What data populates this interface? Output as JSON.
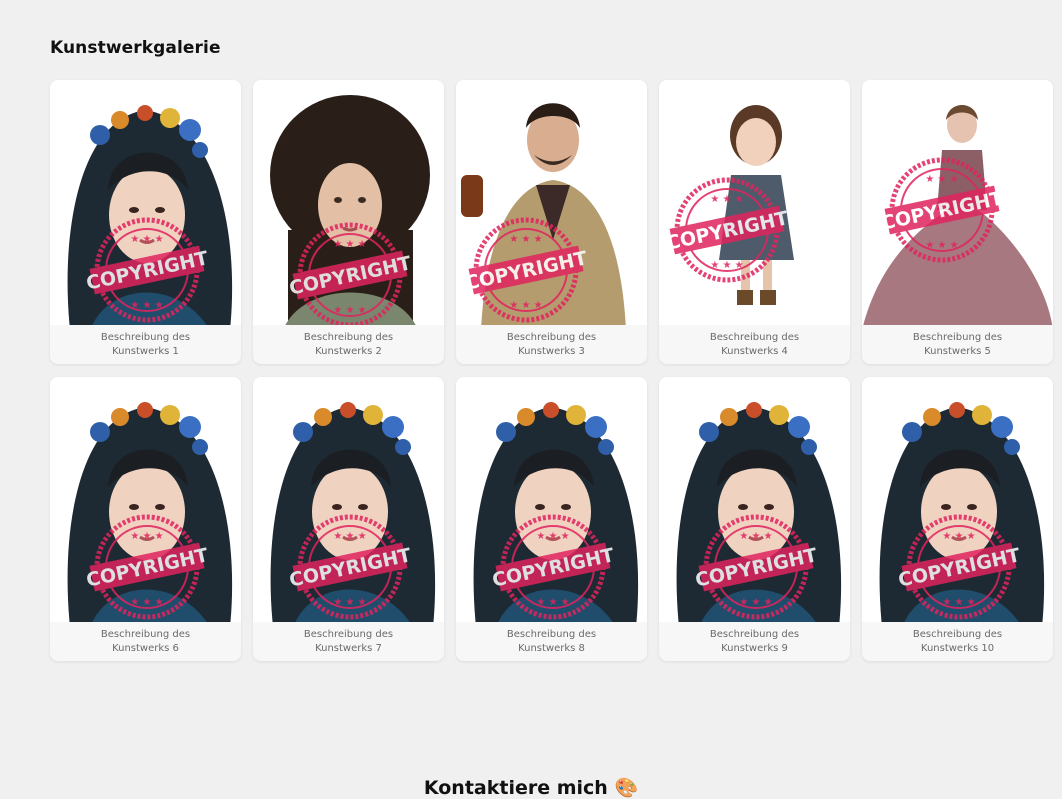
{
  "gallery": {
    "title": "Kunstwerkgalerie",
    "items": [
      {
        "caption_line1": "Beschreibung des",
        "caption_line2": "Kunstwerks 1",
        "subject": "woman-flower-crown",
        "stamp_text": "COPYRIGHT"
      },
      {
        "caption_line1": "Beschreibung des",
        "caption_line2": "Kunstwerks 2",
        "subject": "curly-hair-woman",
        "stamp_text": "COPYRIGHT"
      },
      {
        "caption_line1": "Beschreibung des",
        "caption_line2": "Kunstwerks 3",
        "subject": "man-in-suit",
        "stamp_text": "COPYRIGHT"
      },
      {
        "caption_line1": "Beschreibung des",
        "caption_line2": "Kunstwerks 4",
        "subject": "little-girl",
        "stamp_text": "COPYRIGHT"
      },
      {
        "caption_line1": "Beschreibung des",
        "caption_line2": "Kunstwerks 5",
        "subject": "woman-in-gown",
        "stamp_text": "COPYRIGHT"
      },
      {
        "caption_line1": "Beschreibung des",
        "caption_line2": "Kunstwerks 6",
        "subject": "woman-flower-crown",
        "stamp_text": "COPYRIGHT"
      },
      {
        "caption_line1": "Beschreibung des",
        "caption_line2": "Kunstwerks 7",
        "subject": "woman-flower-crown",
        "stamp_text": "COPYRIGHT"
      },
      {
        "caption_line1": "Beschreibung des",
        "caption_line2": "Kunstwerks 8",
        "subject": "woman-flower-crown",
        "stamp_text": "COPYRIGHT"
      },
      {
        "caption_line1": "Beschreibung des",
        "caption_line2": "Kunstwerks 9",
        "subject": "woman-flower-crown",
        "stamp_text": "COPYRIGHT"
      },
      {
        "caption_line1": "Beschreibung des",
        "caption_line2": "Kunstwerks 10",
        "subject": "woman-flower-crown",
        "stamp_text": "COPYRIGHT"
      }
    ]
  },
  "contact": {
    "title": "Kontaktiere mich",
    "emoji_icon": "palette-icon"
  },
  "colors": {
    "background": "#f0f0f0",
    "stamp": "#e0245e",
    "caption": "#6a6a6a"
  }
}
